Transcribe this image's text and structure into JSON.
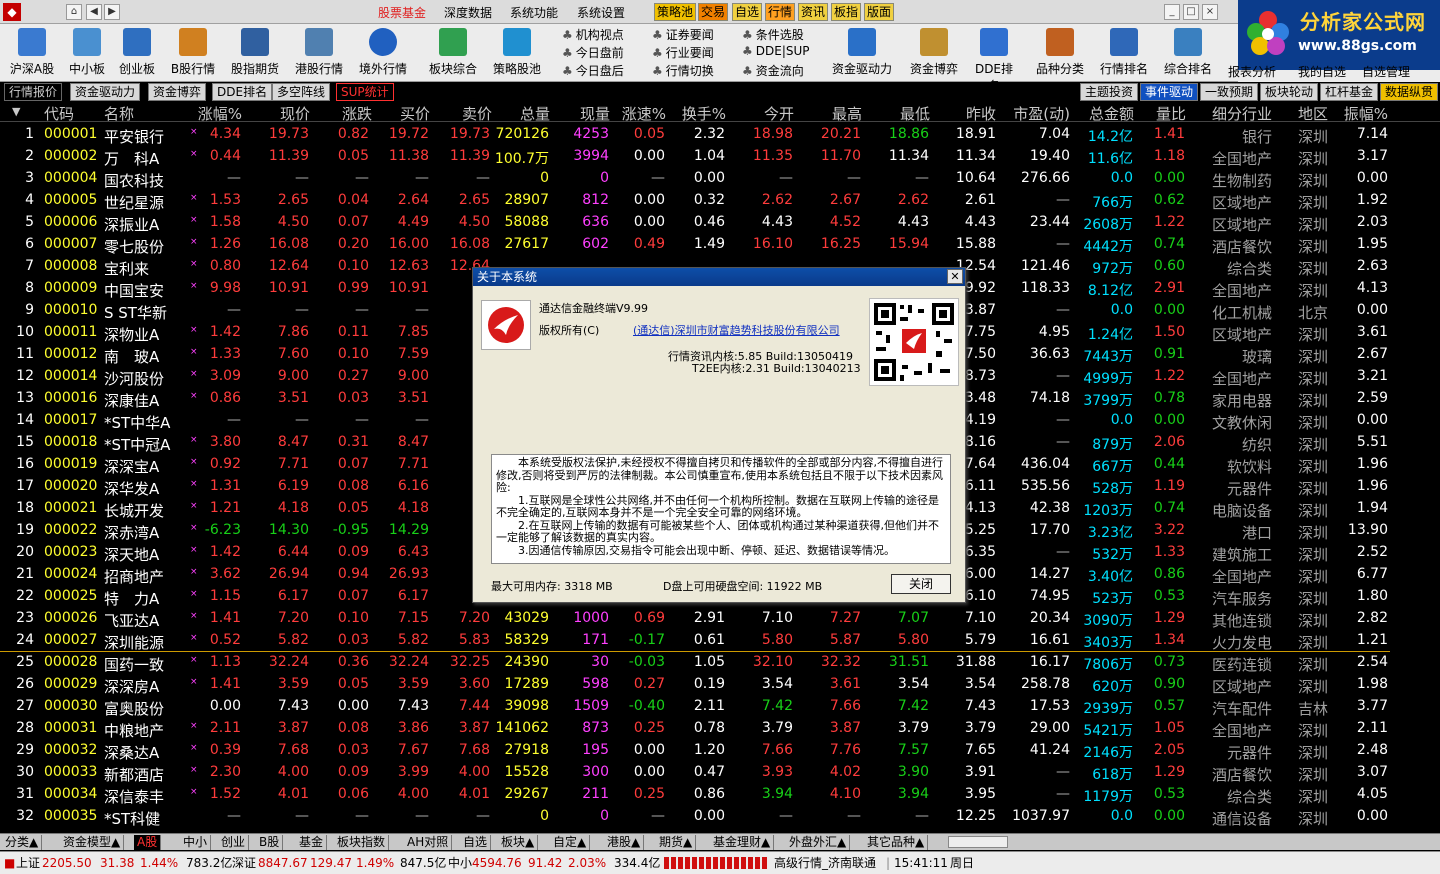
{
  "titlebar": {
    "menus": [
      "股票基金",
      "深度数据",
      "系统功能",
      "系统设置"
    ],
    "quick": [
      "策略池",
      "交易",
      "自选",
      "行情",
      "资讯",
      "板指",
      "版面"
    ]
  },
  "brand": {
    "name": "分析家公式网",
    "url": "www.88gs.com"
  },
  "toolbar": {
    "buttons": [
      "沪深A股",
      "中小板",
      "创业板",
      "B股行情",
      "股指期货",
      "港股行情",
      "境外行情",
      "板块综合",
      "策略股池"
    ],
    "col1": [
      "机构视点",
      "今日盘前",
      "今日盘后"
    ],
    "col2": [
      "证券要闻",
      "行业要闻",
      "行情切换"
    ],
    "col3": [
      "条件选股",
      "DDE|SUP",
      "资金流向"
    ],
    "buttons2": [
      "资金驱动力",
      "资金博弈",
      "DDE排名",
      "品种分类",
      "行情排名",
      "综合排名",
      "报表分析",
      "我的自选",
      "自选管理"
    ]
  },
  "tabs_left": [
    "行情报价",
    "资金驱动力",
    "资金博弈",
    "DDE排名",
    "多空阵线",
    "SUP统计"
  ],
  "tabs_right": [
    "主题投资",
    "事件驱动",
    "一致预期",
    "板块轮动",
    "杠杆基金",
    "数据纵贯"
  ],
  "header": [
    "代码",
    "名称",
    "涨幅%",
    "现价",
    "涨跌",
    "买价",
    "卖价",
    "总量",
    "现量",
    "涨速%",
    "换手%",
    "今开",
    "最高",
    "最低",
    "昨收",
    "市盈(动)",
    "总金额",
    "量比",
    "细分行业",
    "地区",
    "振幅%"
  ],
  "rows": [
    [
      "1",
      "000001",
      "平安银行",
      "4.34",
      "19.73",
      "0.82",
      "19.72",
      "19.73",
      "720126",
      "4253",
      "0.05",
      "2.32",
      "18.98",
      "20.21",
      "18.86",
      "18.91",
      "7.04",
      "14.2亿",
      "1.41",
      "银行",
      "深圳",
      "7.14"
    ],
    [
      "2",
      "000002",
      "万　科A",
      "0.44",
      "11.39",
      "0.05",
      "11.38",
      "11.39",
      "100.7万",
      "3994",
      "0.00",
      "1.04",
      "11.35",
      "11.70",
      "11.34",
      "11.34",
      "19.40",
      "11.6亿",
      "1.18",
      "全国地产",
      "深圳",
      "3.17"
    ],
    [
      "3",
      "000004",
      "国农科技",
      "—",
      "—",
      "—",
      "—",
      "—",
      "0",
      "0",
      "—",
      "0.00",
      "—",
      "—",
      "—",
      "10.64",
      "276.66",
      "0.0",
      "0.00",
      "生物制药",
      "深圳",
      "0.00"
    ],
    [
      "4",
      "000005",
      "世纪星源",
      "1.53",
      "2.65",
      "0.04",
      "2.64",
      "2.65",
      "28907",
      "812",
      "0.00",
      "0.32",
      "2.62",
      "2.67",
      "2.62",
      "2.61",
      "—",
      "766万",
      "0.62",
      "区域地产",
      "深圳",
      "1.92"
    ],
    [
      "5",
      "000006",
      "深振业A",
      "1.58",
      "4.50",
      "0.07",
      "4.49",
      "4.50",
      "58088",
      "636",
      "0.00",
      "0.46",
      "4.43",
      "4.52",
      "4.43",
      "4.43",
      "23.44",
      "2608万",
      "1.22",
      "区域地产",
      "深圳",
      "2.03"
    ],
    [
      "6",
      "000007",
      "零七股份",
      "1.26",
      "16.08",
      "0.20",
      "16.00",
      "16.08",
      "27617",
      "602",
      "0.49",
      "1.49",
      "16.10",
      "16.25",
      "15.94",
      "15.88",
      "—",
      "4442万",
      "0.74",
      "酒店餐饮",
      "深圳",
      "1.95"
    ],
    [
      "7",
      "000008",
      "宝利来",
      "0.80",
      "12.64",
      "0.10",
      "12.63",
      "12.64",
      "",
      "",
      "",
      "",
      "",
      "",
      "",
      "12.54",
      "121.46",
      "972万",
      "0.60",
      "综合类",
      "深圳",
      "2.63"
    ],
    [
      "8",
      "000009",
      "中国宝安",
      "9.98",
      "10.91",
      "0.99",
      "10.91",
      "",
      "",
      "",
      "",
      "",
      "",
      "",
      "",
      "9.92",
      "118.33",
      "8.12亿",
      "2.91",
      "全国地产",
      "深圳",
      "4.13"
    ],
    [
      "9",
      "000010",
      "S ST华新",
      "—",
      "—",
      "—",
      "—",
      "",
      "",
      "",
      "",
      "",
      "",
      "",
      "",
      "3.87",
      "—",
      "0.0",
      "0.00",
      "化工机械",
      "北京",
      "0.00"
    ],
    [
      "10",
      "000011",
      "深物业A",
      "1.42",
      "7.86",
      "0.11",
      "7.85",
      "",
      "",
      "",
      "",
      "",
      "",
      "",
      "",
      "7.75",
      "4.95",
      "1.24亿",
      "1.50",
      "区域地产",
      "深圳",
      "3.61"
    ],
    [
      "11",
      "000012",
      "南　玻A",
      "1.33",
      "7.60",
      "0.10",
      "7.59",
      "",
      "",
      "",
      "",
      "",
      "",
      "",
      "",
      "7.50",
      "36.63",
      "7443万",
      "0.91",
      "玻璃",
      "深圳",
      "2.67"
    ],
    [
      "12",
      "000014",
      "沙河股份",
      "3.09",
      "9.00",
      "0.27",
      "9.00",
      "",
      "",
      "",
      "",
      "",
      "",
      "",
      "",
      "8.73",
      "—",
      "4999万",
      "1.22",
      "全国地产",
      "深圳",
      "3.21"
    ],
    [
      "13",
      "000016",
      "深康佳A",
      "0.86",
      "3.51",
      "0.03",
      "3.51",
      "",
      "",
      "",
      "",
      "",
      "",
      "",
      "",
      "3.48",
      "74.18",
      "3799万",
      "0.78",
      "家用电器",
      "深圳",
      "2.59"
    ],
    [
      "14",
      "000017",
      "*ST中华A",
      "—",
      "—",
      "—",
      "—",
      "",
      "",
      "",
      "",
      "",
      "",
      "",
      "",
      "4.19",
      "—",
      "0.0",
      "0.00",
      "文教休闲",
      "深圳",
      "0.00"
    ],
    [
      "15",
      "000018",
      "*ST中冠A",
      "3.80",
      "8.47",
      "0.31",
      "8.47",
      "",
      "",
      "",
      "",
      "",
      "",
      "",
      "",
      "8.16",
      "—",
      "879万",
      "2.06",
      "纺织",
      "深圳",
      "5.51"
    ],
    [
      "16",
      "000019",
      "深深宝A",
      "0.92",
      "7.71",
      "0.07",
      "7.71",
      "",
      "",
      "",
      "",
      "",
      "",
      "",
      "",
      "7.64",
      "436.04",
      "667万",
      "0.44",
      "软饮料",
      "深圳",
      "1.96"
    ],
    [
      "17",
      "000020",
      "深华发A",
      "1.31",
      "6.19",
      "0.08",
      "6.16",
      "",
      "",
      "",
      "",
      "",
      "",
      "",
      "",
      "6.11",
      "535.56",
      "528万",
      "1.19",
      "元器件",
      "深圳",
      "1.96"
    ],
    [
      "18",
      "000021",
      "长城开发",
      "1.21",
      "4.18",
      "0.05",
      "4.18",
      "",
      "",
      "",
      "",
      "",
      "",
      "",
      "",
      "4.13",
      "42.38",
      "1203万",
      "0.74",
      "电脑设备",
      "深圳",
      "1.94"
    ],
    [
      "19",
      "000022",
      "深赤湾A",
      "-6.23",
      "14.30",
      "-0.95",
      "14.29",
      "",
      "",
      "",
      "",
      "",
      "",
      "",
      "",
      "15.25",
      "17.70",
      "3.23亿",
      "3.22",
      "港口",
      "深圳",
      "13.90"
    ],
    [
      "20",
      "000023",
      "深天地A",
      "1.42",
      "6.44",
      "0.09",
      "6.43",
      "",
      "",
      "",
      "",
      "",
      "",
      "",
      "",
      "6.35",
      "—",
      "532万",
      "1.33",
      "建筑施工",
      "深圳",
      "2.52"
    ],
    [
      "21",
      "000024",
      "招商地产",
      "3.62",
      "26.94",
      "0.94",
      "26.93",
      "",
      "",
      "",
      "",
      "",
      "",
      "",
      "",
      "26.00",
      "14.27",
      "3.40亿",
      "0.86",
      "全国地产",
      "深圳",
      "6.77"
    ],
    [
      "22",
      "000025",
      "特　力A",
      "1.15",
      "6.17",
      "0.07",
      "6.17",
      "",
      "",
      "",
      "",
      "",
      "",
      "",
      "",
      "6.10",
      "74.95",
      "523万",
      "0.53",
      "汽车服务",
      "深圳",
      "1.80"
    ],
    [
      "23",
      "000026",
      "飞亚达A",
      "1.41",
      "7.20",
      "0.10",
      "7.15",
      "7.20",
      "43029",
      "1000",
      "0.69",
      "2.91",
      "7.10",
      "7.27",
      "7.07",
      "7.10",
      "20.34",
      "3090万",
      "1.29",
      "其他连锁",
      "深圳",
      "2.82"
    ],
    [
      "24",
      "000027",
      "深圳能源",
      "0.52",
      "5.82",
      "0.03",
      "5.82",
      "5.83",
      "58329",
      "171",
      "-0.17",
      "0.61",
      "5.80",
      "5.87",
      "5.80",
      "5.79",
      "16.61",
      "3403万",
      "1.34",
      "火力发电",
      "深圳",
      "1.21"
    ],
    [
      "25",
      "000028",
      "国药一致",
      "1.13",
      "32.24",
      "0.36",
      "32.24",
      "32.25",
      "24390",
      "30",
      "-0.03",
      "1.05",
      "32.10",
      "32.32",
      "31.51",
      "31.88",
      "16.17",
      "7806万",
      "0.73",
      "医药连锁",
      "深圳",
      "2.54"
    ],
    [
      "26",
      "000029",
      "深深房A",
      "1.41",
      "3.59",
      "0.05",
      "3.59",
      "3.60",
      "17289",
      "598",
      "0.27",
      "0.19",
      "3.54",
      "3.61",
      "3.54",
      "3.54",
      "258.78",
      "620万",
      "0.90",
      "区域地产",
      "深圳",
      "1.98"
    ],
    [
      "27",
      "000030",
      "富奥股份",
      "0.00",
      "7.43",
      "0.00",
      "7.43",
      "7.44",
      "39098",
      "1509",
      "-0.40",
      "2.11",
      "7.42",
      "7.66",
      "7.42",
      "7.43",
      "17.53",
      "2939万",
      "0.57",
      "汽车配件",
      "吉林",
      "3.77"
    ],
    [
      "28",
      "000031",
      "中粮地产",
      "2.11",
      "3.87",
      "0.08",
      "3.86",
      "3.87",
      "141062",
      "873",
      "0.25",
      "0.78",
      "3.79",
      "3.87",
      "3.79",
      "3.79",
      "29.00",
      "5421万",
      "1.05",
      "全国地产",
      "深圳",
      "2.11"
    ],
    [
      "29",
      "000032",
      "深桑达A",
      "0.39",
      "7.68",
      "0.03",
      "7.67",
      "7.68",
      "27918",
      "195",
      "0.00",
      "1.20",
      "7.66",
      "7.76",
      "7.57",
      "7.65",
      "41.24",
      "2146万",
      "2.05",
      "元器件",
      "深圳",
      "2.48"
    ],
    [
      "30",
      "000033",
      "新都酒店",
      "2.30",
      "4.00",
      "0.09",
      "3.99",
      "4.00",
      "15528",
      "300",
      "0.00",
      "0.47",
      "3.93",
      "4.02",
      "3.90",
      "3.91",
      "—",
      "618万",
      "1.29",
      "酒店餐饮",
      "深圳",
      "3.07"
    ],
    [
      "31",
      "000034",
      "深信泰丰",
      "1.52",
      "4.01",
      "0.06",
      "4.00",
      "4.01",
      "29267",
      "211",
      "0.25",
      "0.86",
      "3.94",
      "4.10",
      "3.94",
      "3.95",
      "—",
      "1179万",
      "0.53",
      "综合类",
      "深圳",
      "4.05"
    ],
    [
      "32",
      "000035",
      "*ST科健",
      "—",
      "—",
      "—",
      "—",
      "—",
      "0",
      "0",
      "—",
      "0.00",
      "—",
      "—",
      "—",
      "12.25",
      "1037.97",
      "0.0",
      "0.00",
      "通信设备",
      "深圳",
      "0.00"
    ]
  ],
  "bottom_tabs": [
    "分类▲",
    "资金模型▲",
    "A股",
    "中小",
    "创业",
    "B股",
    "基金",
    "板块指数",
    "AH对照",
    "自选",
    "板块▲",
    "自定▲",
    "港股▲",
    "期货▲",
    "基金理财▲",
    "外盘外汇▲",
    "其它品种▲"
  ],
  "status": {
    "sh_label": "上证",
    "sh_val": "2205.50",
    "sh_chg": "31.38",
    "sh_pct": "1.44%",
    "sh_amt": "783.2亿",
    "sz_label": "深证",
    "sz_val": "8847.67",
    "sz_chg": "129.47",
    "sz_pct": "1.49%",
    "sz_amt": "847.5亿",
    "zx_label": "中小",
    "zx_val": "4594.76",
    "zx_chg": "91.42",
    "zx_pct": "2.03%",
    "zx_amt": "334.4亿",
    "feed": "高级行情_济南联通",
    "time": "15:41:11",
    "week": "周日"
  },
  "dialog": {
    "title": "关于本系统",
    "close_x": "✕",
    "product": "通达信金融终端V9.99",
    "copyright": "版权所有(C)",
    "company": "(通达信)深圳市财富趋势科技股份有限公司",
    "core1": "行情资讯内核:5.85 Build:13050419",
    "core2": "T2EE内核:2.31 Build:13040213",
    "warn1": "本系统受版权法保护,未经授权不得擅自拷贝和传播软件的全部或部分内容,不得擅自进行修改,否则将受到严厉的法律制裁。本公司慎重宣布,使用本系统包括且不限于以下技术因素风险:",
    "warn2": "1.互联网是全球性公共网络,并不由任何一个机构所控制。数据在互联网上传输的途径是不完全确定的,互联网本身并不是一个完全安全可靠的网络环境。",
    "warn3": "2.在互联网上传输的数据有可能被某些个人、团体或机构通过某种渠道获得,但他们并不一定能够了解该数据的真实内容。",
    "warn4": "3.因通信传输原因,交易指令可能会出现中断、停顿、延迟、数据错误等情况。",
    "mem": "最大可用内存: 3318 MB",
    "disk": "D盘上可用硬盘空间: 11922 MB",
    "btn": "关闭"
  },
  "colors": {
    "up": "#ff3c3c",
    "down": "#18d018",
    "amount": "#00e0ff",
    "volume": "#ffff30",
    "tick": "#ff40ff"
  }
}
